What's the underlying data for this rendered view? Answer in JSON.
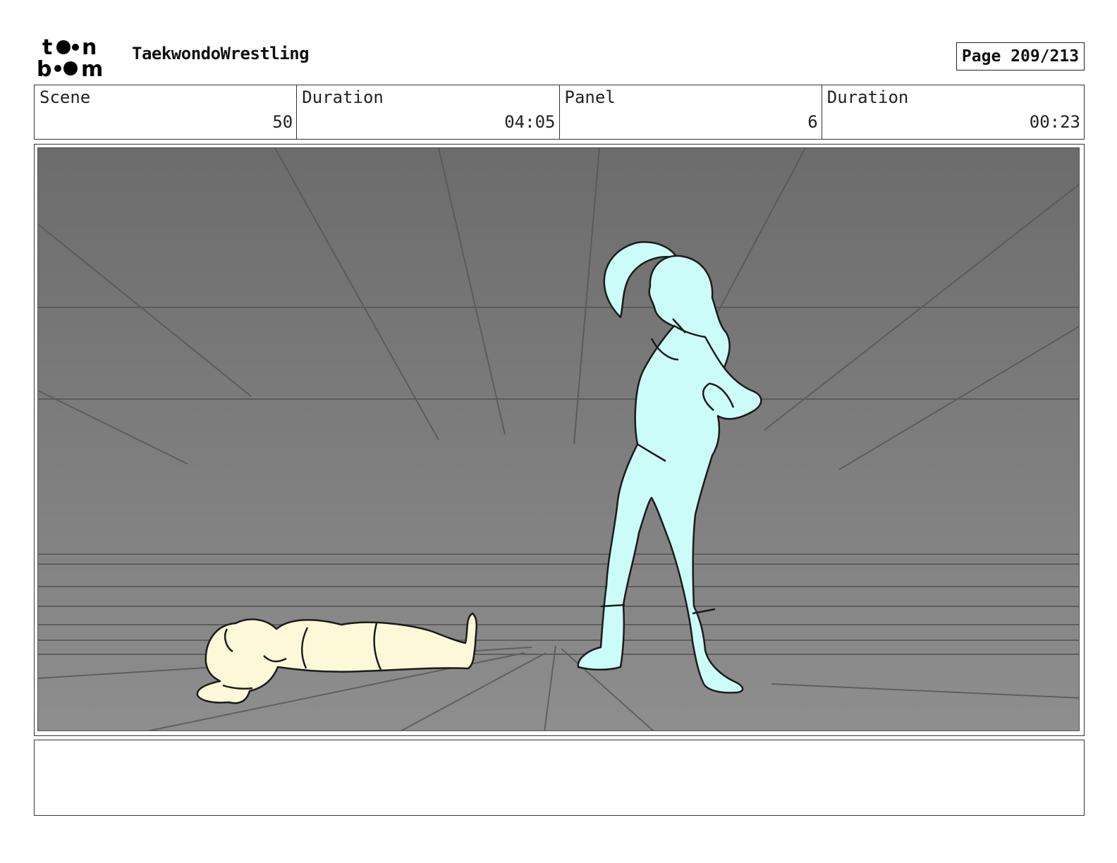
{
  "header": {
    "logo_text": [
      "t",
      "n",
      "b",
      "m"
    ],
    "project_title": "TaekwondoWrestling",
    "page_label": "Page 209/213"
  },
  "info": {
    "scene_label": "Scene",
    "scene_value": "50",
    "scene_duration_label": "Duration",
    "scene_duration_value": "04:05",
    "panel_label": "Panel",
    "panel_value": "6",
    "panel_duration_label": "Duration",
    "panel_duration_value": "00:23"
  },
  "panel": {
    "background_top": "#6c6c6c",
    "background_bottom": "#8e8e8e",
    "figure_standing_color": "#ccfcf8",
    "figure_lying_color": "#fdf9d8"
  },
  "notes": {
    "text": ""
  }
}
